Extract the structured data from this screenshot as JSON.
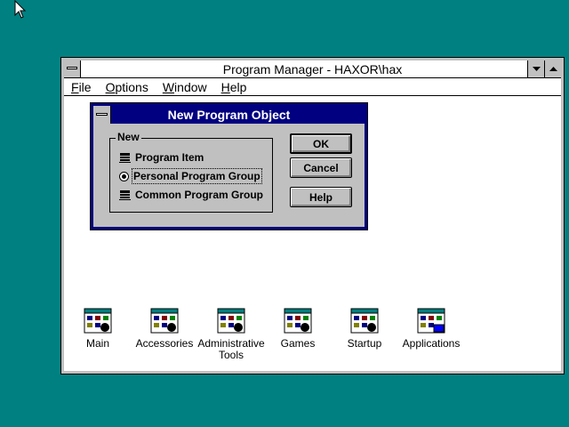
{
  "window": {
    "title": "Program Manager - HAXOR\\hax",
    "menu": [
      "File",
      "Options",
      "Window",
      "Help"
    ],
    "menu_underline": [
      "F",
      "O",
      "W",
      "H"
    ]
  },
  "dialog": {
    "title": "New Program Object",
    "group_label": "New",
    "options": [
      {
        "label": "Program Item",
        "selected": false
      },
      {
        "label": "Personal Program Group",
        "selected": true
      },
      {
        "label": "Common Program Group",
        "selected": false
      }
    ],
    "buttons": {
      "ok": "OK",
      "cancel": "Cancel",
      "help": "Help"
    }
  },
  "icons": [
    {
      "label_1": "Main",
      "label_2": ""
    },
    {
      "label_1": "Accessories",
      "label_2": ""
    },
    {
      "label_1": "Administrative",
      "label_2": "Tools"
    },
    {
      "label_1": "Games",
      "label_2": ""
    },
    {
      "label_1": "Startup",
      "label_2": ""
    },
    {
      "label_1": "Applications",
      "label_2": ""
    }
  ],
  "colors": {
    "desktop": "#008080",
    "title_active": "#000080",
    "face": "#c0c0c0"
  }
}
